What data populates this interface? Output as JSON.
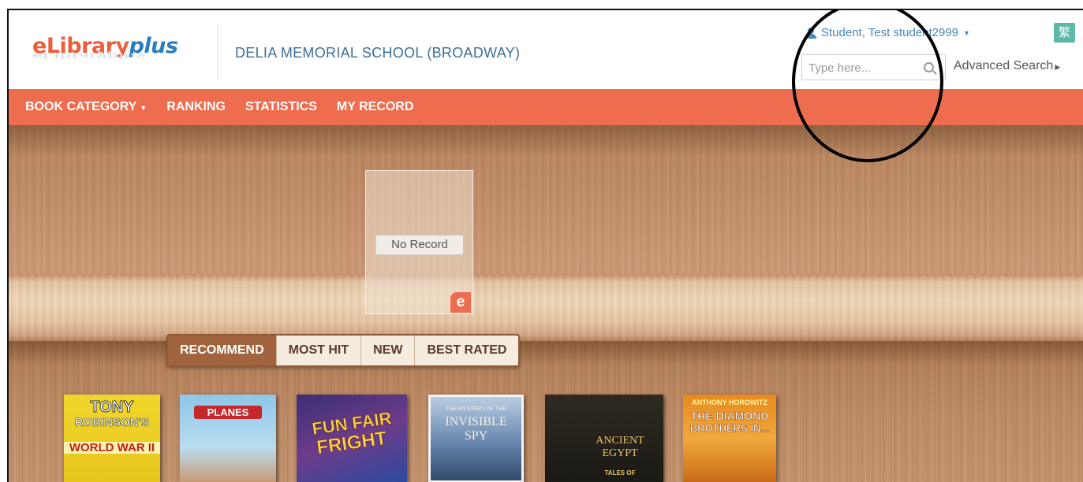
{
  "header": {
    "logo_text": {
      "e": "e",
      "library": "Library",
      "plus": "plus"
    },
    "logo_reflection": "eLibraryplus",
    "school_name": "DELIA MEMORIAL SCHOOL (BROADWAY)",
    "user_name": "Student, Test student2999",
    "language_button": "繁",
    "search": {
      "placeholder": "Type here..."
    },
    "advanced_search": "Advanced Search"
  },
  "nav": {
    "items": [
      {
        "label": "BOOK CATEGORY",
        "dropdown": true
      },
      {
        "label": "RANKING"
      },
      {
        "label": "STATISTICS"
      },
      {
        "label": "MY RECORD"
      }
    ]
  },
  "shelf": {
    "no_record": "No Record",
    "badge": "e"
  },
  "tabs": [
    {
      "label": "RECOMMEND",
      "active": true
    },
    {
      "label": "MOST HIT"
    },
    {
      "label": "NEW"
    },
    {
      "label": "BEST RATED"
    }
  ],
  "books": [
    {
      "title_lines": [
        "TONY",
        "ROBINSON'S",
        "WORLD WAR II"
      ]
    },
    {
      "title_lines": [
        "PLANES"
      ]
    },
    {
      "title_lines": [
        "FUN FAIR",
        "FRIGHT"
      ]
    },
    {
      "title_lines": [
        "THE MYSTERY OF THE",
        "INVISIBLE",
        "SPY"
      ]
    },
    {
      "title_lines": [
        "ANCIENT",
        "EGYPT",
        "TALES OF"
      ]
    },
    {
      "title_lines": [
        "ANTHONY HOROWITZ",
        "THE DIAMOND",
        "BROTHERS IN..."
      ]
    }
  ],
  "colors": {
    "accent": "#ee6d4e",
    "link": "#4a87b8",
    "lang_button": "#5cb8a8",
    "tab_active": "#a2643e"
  }
}
